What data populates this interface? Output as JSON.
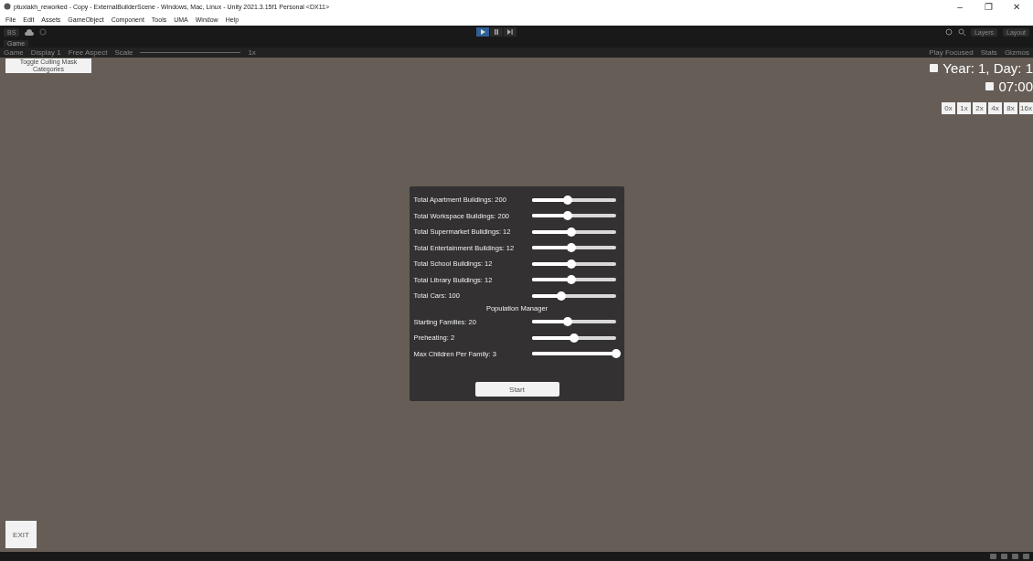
{
  "window": {
    "title": "ptuxiakh_reworked - Copy - ExternalBuilderScene - Windows, Mac, Linux - Unity 2021.3.15f1 Personal <DX11>",
    "controls": [
      "–",
      "❐",
      "✕"
    ]
  },
  "menu": [
    "File",
    "Edit",
    "Assets",
    "GameObject",
    "Component",
    "Tools",
    "UMA",
    "Window",
    "Help"
  ],
  "toolbar": {
    "account": "BS",
    "play": {
      "playing": true
    },
    "layers": "Layers",
    "layout": "Layout"
  },
  "game_tab": {
    "label": "Game"
  },
  "game_toolbar": {
    "view": "Game",
    "display": "Display 1",
    "aspect": "Free Aspect",
    "scale_label": "Scale",
    "scale_value": "1x",
    "play_mode": "Play Focused",
    "stats": "Stats",
    "gizmos": "Gizmos"
  },
  "game_view": {
    "toggle_button": "Toggle Culling Mask Categories",
    "date": "Year: 1, Day: 1",
    "time": "07:00",
    "speed_buttons": [
      "0x",
      "1x",
      "2x",
      "4x",
      "8x",
      "16x"
    ],
    "exit_button": "EXIT",
    "settings_panel": {
      "rows": [
        {
          "kind": "slider",
          "label": "Total Apartment Buildings: 200",
          "level": 0.43
        },
        {
          "kind": "slider",
          "label": "Total Workspace Buildings: 200",
          "level": 0.43
        },
        {
          "kind": "slider",
          "label": "Total Supermarket Buildings: 12",
          "level": 0.47
        },
        {
          "kind": "slider",
          "label": "Total Entertainment Buildings: 12",
          "level": 0.47
        },
        {
          "kind": "slider",
          "label": "Total School Buildings: 12",
          "level": 0.47
        },
        {
          "kind": "slider",
          "label": "Total Library Buildings: 12",
          "level": 0.47
        },
        {
          "kind": "slider",
          "label": "Total Cars: 100",
          "level": 0.35
        },
        {
          "kind": "heading",
          "label": "Population Manager"
        },
        {
          "kind": "slider",
          "label": "Starting Families: 20",
          "level": 0.43
        },
        {
          "kind": "slider",
          "label": "Preheating: 2",
          "level": 0.5
        },
        {
          "kind": "slider",
          "label": "Max Children Per Family: 3",
          "level": 1.0
        }
      ],
      "start_button": "Start"
    }
  }
}
